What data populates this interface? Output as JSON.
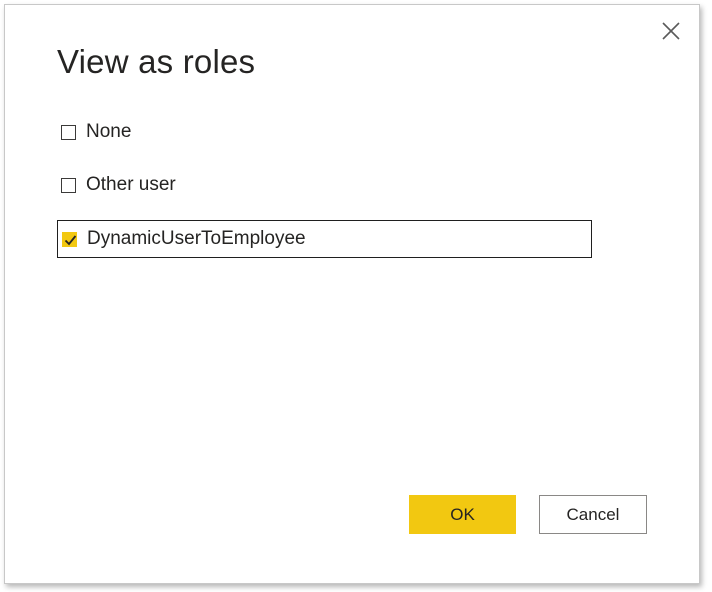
{
  "dialog": {
    "title": "View as roles",
    "close_icon": "close-icon",
    "options": [
      {
        "label": "None",
        "checked": false
      },
      {
        "label": "Other user",
        "checked": false
      },
      {
        "label": "DynamicUserToEmployee",
        "checked": true
      }
    ],
    "ok_label": "OK",
    "cancel_label": "Cancel"
  },
  "colors": {
    "accent": "#f2c811",
    "text": "#252423",
    "border": "#8a8886"
  }
}
